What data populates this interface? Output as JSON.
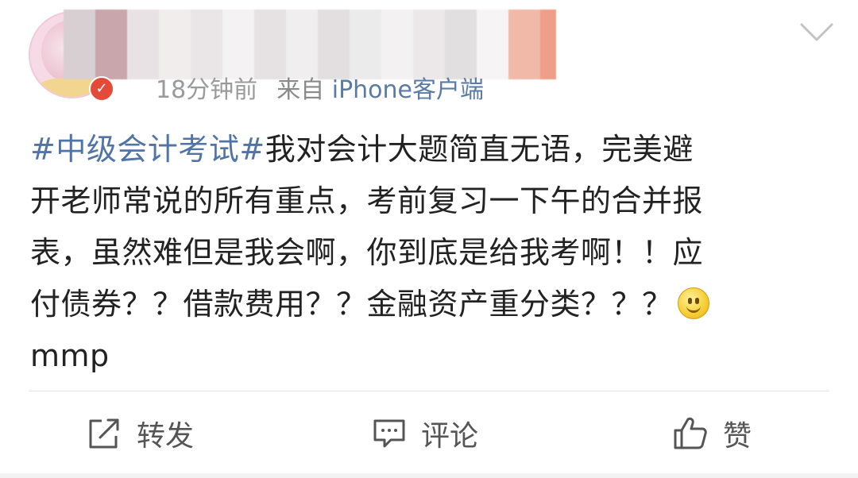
{
  "post": {
    "timestamp": "18分钟前",
    "source_prefix": "来自",
    "source_name": "iPhone客户端",
    "content": {
      "topic": "#中级会计考试#",
      "line1_rest": "我对会计大题简直无语，完美避",
      "line2": "开老师常说的所有重点，考前复习一下午的合并报",
      "line3": "表，虽然难但是我会啊，你到底是给我考啊！！应",
      "line4": "付债券？？借款费用？？金融资产重分类？？？",
      "line5": "mmp"
    },
    "emoji": "smile-emoji",
    "actions": {
      "repost_label": "转发",
      "comment_label": "评论",
      "like_label": "赞"
    }
  },
  "colors": {
    "topic": "#4f74a5",
    "text": "#222222",
    "meta": "#8a8a8a",
    "source_link": "#5a7ba7",
    "action_text": "#555555",
    "divider": "#e5e5e5"
  },
  "icons": [
    "avatar",
    "verified-badge",
    "chevron-down-icon",
    "repost-icon",
    "comment-icon",
    "like-icon",
    "smile-emoji"
  ]
}
